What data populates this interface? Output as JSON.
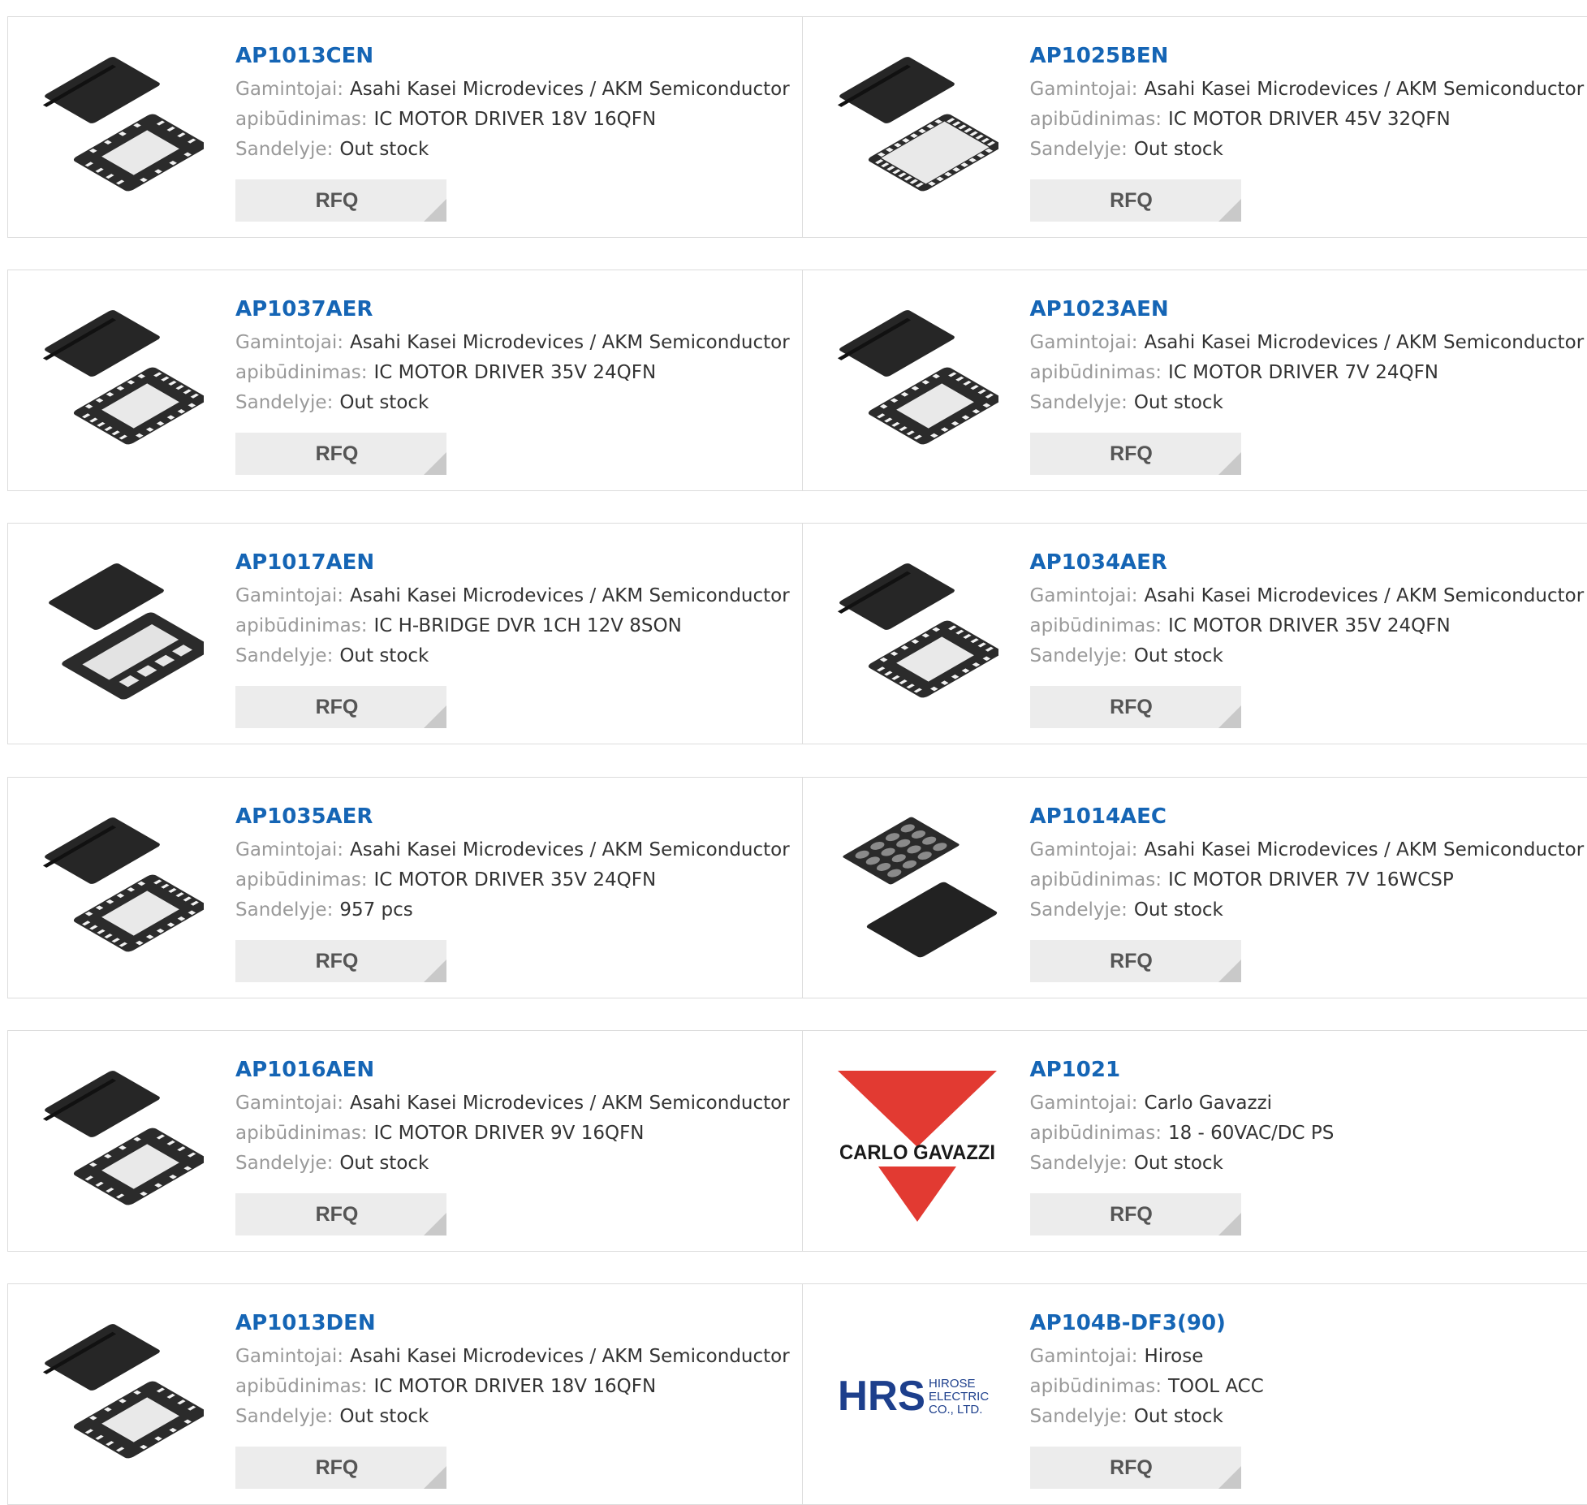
{
  "labels": {
    "manufacturer": "Gamintojai:",
    "description": "apibūdinimas:",
    "stock": "Sandelyje:",
    "rfq": "RFQ"
  },
  "colors": {
    "link": "#1565b5",
    "label": "#999999",
    "value": "#333333",
    "button": "#ececec"
  },
  "products": [
    {
      "part": "AP1013CEN",
      "manufacturer": "Asahi Kasei Microdevices / AKM Semiconductor",
      "description": "IC MOTOR DRIVER 18V 16QFN",
      "stock": "Out stock",
      "image": "qfn16-chip"
    },
    {
      "part": "AP1025BEN",
      "manufacturer": "Asahi Kasei Microdevices / AKM Semiconductor",
      "description": "IC MOTOR DRIVER 45V 32QFN",
      "stock": "Out stock",
      "image": "qfn32-chip"
    },
    {
      "part": "AP1037AER",
      "manufacturer": "Asahi Kasei Microdevices / AKM Semiconductor",
      "description": "IC MOTOR DRIVER 35V 24QFN",
      "stock": "Out stock",
      "image": "qfn24-chip"
    },
    {
      "part": "AP1023AEN",
      "manufacturer": "Asahi Kasei Microdevices / AKM Semiconductor",
      "description": "IC MOTOR DRIVER 7V 24QFN",
      "stock": "Out stock",
      "image": "qfn24-chip"
    },
    {
      "part": "AP1017AEN",
      "manufacturer": "Asahi Kasei Microdevices / AKM Semiconductor",
      "description": "IC H-BRIDGE DVR 1CH 12V 8SON",
      "stock": "Out stock",
      "image": "son8-chip"
    },
    {
      "part": "AP1034AER",
      "manufacturer": "Asahi Kasei Microdevices / AKM Semiconductor",
      "description": "IC MOTOR DRIVER 35V 24QFN",
      "stock": "Out stock",
      "image": "qfn24-chip"
    },
    {
      "part": "AP1035AER",
      "manufacturer": "Asahi Kasei Microdevices / AKM Semiconductor",
      "description": "IC MOTOR DRIVER 35V 24QFN",
      "stock": "957 pcs",
      "image": "qfn24-chip"
    },
    {
      "part": "AP1014AEC",
      "manufacturer": "Asahi Kasei Microdevices / AKM Semiconductor",
      "description": "IC MOTOR DRIVER 7V 16WCSP",
      "stock": "Out stock",
      "image": "wcsp-chip"
    },
    {
      "part": "AP1016AEN",
      "manufacturer": "Asahi Kasei Microdevices / AKM Semiconductor",
      "description": "IC MOTOR DRIVER 9V 16QFN",
      "stock": "Out stock",
      "image": "qfn16-chip"
    },
    {
      "part": "AP1021",
      "manufacturer": "Carlo Gavazzi",
      "description": "18 - 60VAC/DC PS",
      "stock": "Out stock",
      "image": "carlo-gavazzi-logo",
      "logo_text": "CARLO GAVAZZI"
    },
    {
      "part": "AP1013DEN",
      "manufacturer": "Asahi Kasei Microdevices / AKM Semiconductor",
      "description": "IC MOTOR DRIVER 18V 16QFN",
      "stock": "Out stock",
      "image": "qfn16-chip"
    },
    {
      "part": "AP104B-DF3(90)",
      "manufacturer": "Hirose",
      "description": "TOOL ACC",
      "stock": "Out stock",
      "image": "hirose-logo",
      "logo_text": "HRS",
      "logo_subtext": [
        "HIROSE",
        "ELECTRIC",
        "CO., LTD."
      ]
    }
  ]
}
